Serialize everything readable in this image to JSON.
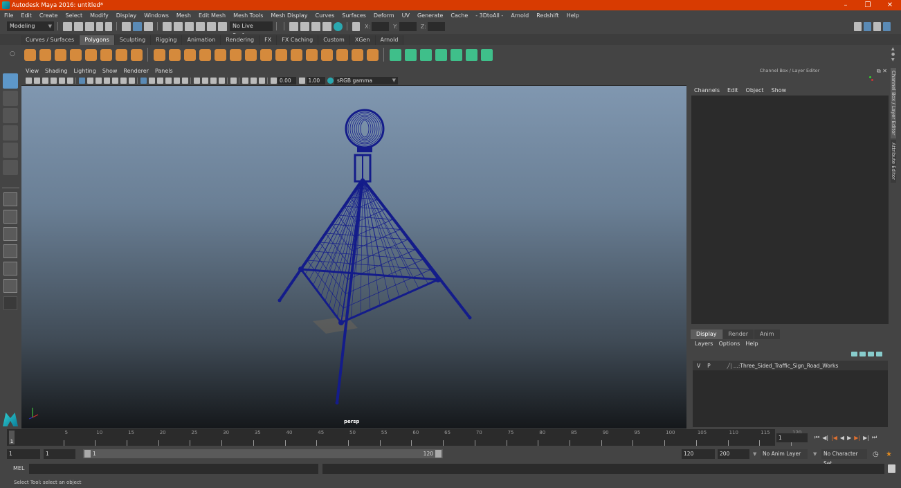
{
  "window": {
    "title": "Autodesk Maya 2016: untitled*",
    "controls": [
      "minimize-icon",
      "restore-icon",
      "close-icon"
    ],
    "accent_color": "#d83b01"
  },
  "menubar": [
    "File",
    "Edit",
    "Create",
    "Select",
    "Modify",
    "Display",
    "Windows",
    "Mesh",
    "Edit Mesh",
    "Mesh Tools",
    "Mesh Display",
    "Curves",
    "Surfaces",
    "Deform",
    "UV",
    "Generate",
    "Cache",
    "- 3DtoAll -",
    "Arnold",
    "Redshift",
    "Help"
  ],
  "statusline": {
    "mode": "Modeling",
    "live_surface": "No Live Surface",
    "x_label": "X:",
    "y_label": "Y:",
    "z_label": "Z:"
  },
  "shelf": {
    "tabs": [
      "Curves / Surfaces",
      "Polygons",
      "Sculpting",
      "Rigging",
      "Animation",
      "Rendering",
      "FX",
      "FX Caching",
      "Custom",
      "XGen",
      "Arnold"
    ],
    "active_tab": "Polygons"
  },
  "viewport": {
    "menu": [
      "View",
      "Shading",
      "Lighting",
      "Show",
      "Renderer",
      "Panels"
    ],
    "exposure": "0.00",
    "gamma": "1.00",
    "color_space": "sRGB gamma",
    "camera_label": "persp",
    "wireframe_color": "#141c8a"
  },
  "channel_box": {
    "title": "Channel Box / Layer Editor",
    "menu": [
      "Channels",
      "Edit",
      "Object",
      "Show"
    ]
  },
  "layer_editor": {
    "tabs": [
      "Display",
      "Render",
      "Anim"
    ],
    "active_tab": "Display",
    "menu": [
      "Layers",
      "Options",
      "Help"
    ],
    "layers": [
      {
        "visible": "V",
        "playback": "P",
        "name": "...:Three_Sided_Traffic_Sign_Road_Works"
      }
    ]
  },
  "side_tabs": [
    "Channel Box / Layer Editor",
    "Attribute Editor"
  ],
  "timeline": {
    "ticks": [
      "5",
      "10",
      "15",
      "20",
      "25",
      "30",
      "35",
      "40",
      "45",
      "50",
      "55",
      "60",
      "65",
      "70",
      "75",
      "80",
      "85",
      "90",
      "95",
      "100",
      "105",
      "110",
      "115",
      "120"
    ],
    "current_frame_marker": "1",
    "current_frame": "1"
  },
  "range": {
    "start": "1",
    "playback_start": "1",
    "slider_start": "1",
    "slider_end": "120",
    "playback_end": "120",
    "end": "200",
    "anim_layer": "No Anim Layer",
    "character_set": "No Character Set"
  },
  "command_line": {
    "language": "MEL"
  },
  "status": {
    "help_text": "Select Tool: select an object"
  }
}
